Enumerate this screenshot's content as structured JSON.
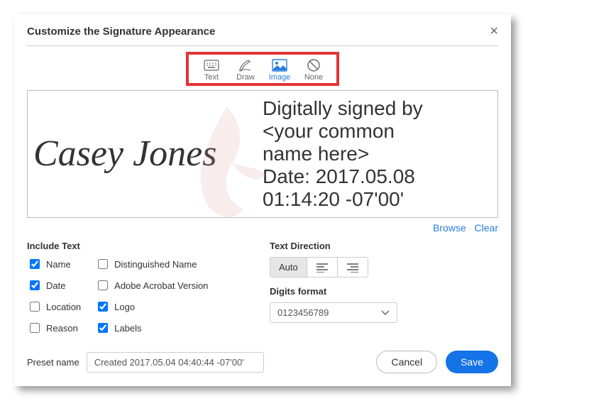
{
  "dialog": {
    "title": "Customize the Signature Appearance"
  },
  "modes": {
    "text": "Text",
    "draw": "Draw",
    "image": "Image",
    "none": "None"
  },
  "preview": {
    "signature_name": "Casey Jones",
    "details_line1": "Digitally signed by",
    "details_line2": "<your common",
    "details_line3": "name here>",
    "details_line4": "Date: 2017.05.08",
    "details_line5": "01:14:20 -07'00'"
  },
  "links": {
    "browse": "Browse",
    "clear": "Clear"
  },
  "include_text": {
    "heading": "Include Text",
    "name": "Name",
    "date": "Date",
    "location": "Location",
    "reason": "Reason",
    "dn": "Distinguished Name",
    "version": "Adobe Acrobat Version",
    "logo": "Logo",
    "labels": "Labels"
  },
  "text_direction": {
    "heading": "Text Direction",
    "auto": "Auto"
  },
  "digits": {
    "heading": "Digits format",
    "value": "0123456789"
  },
  "preset": {
    "label": "Preset name",
    "value": "Created 2017.05.04 04:40:44 -07'00'"
  },
  "buttons": {
    "cancel": "Cancel",
    "save": "Save"
  }
}
